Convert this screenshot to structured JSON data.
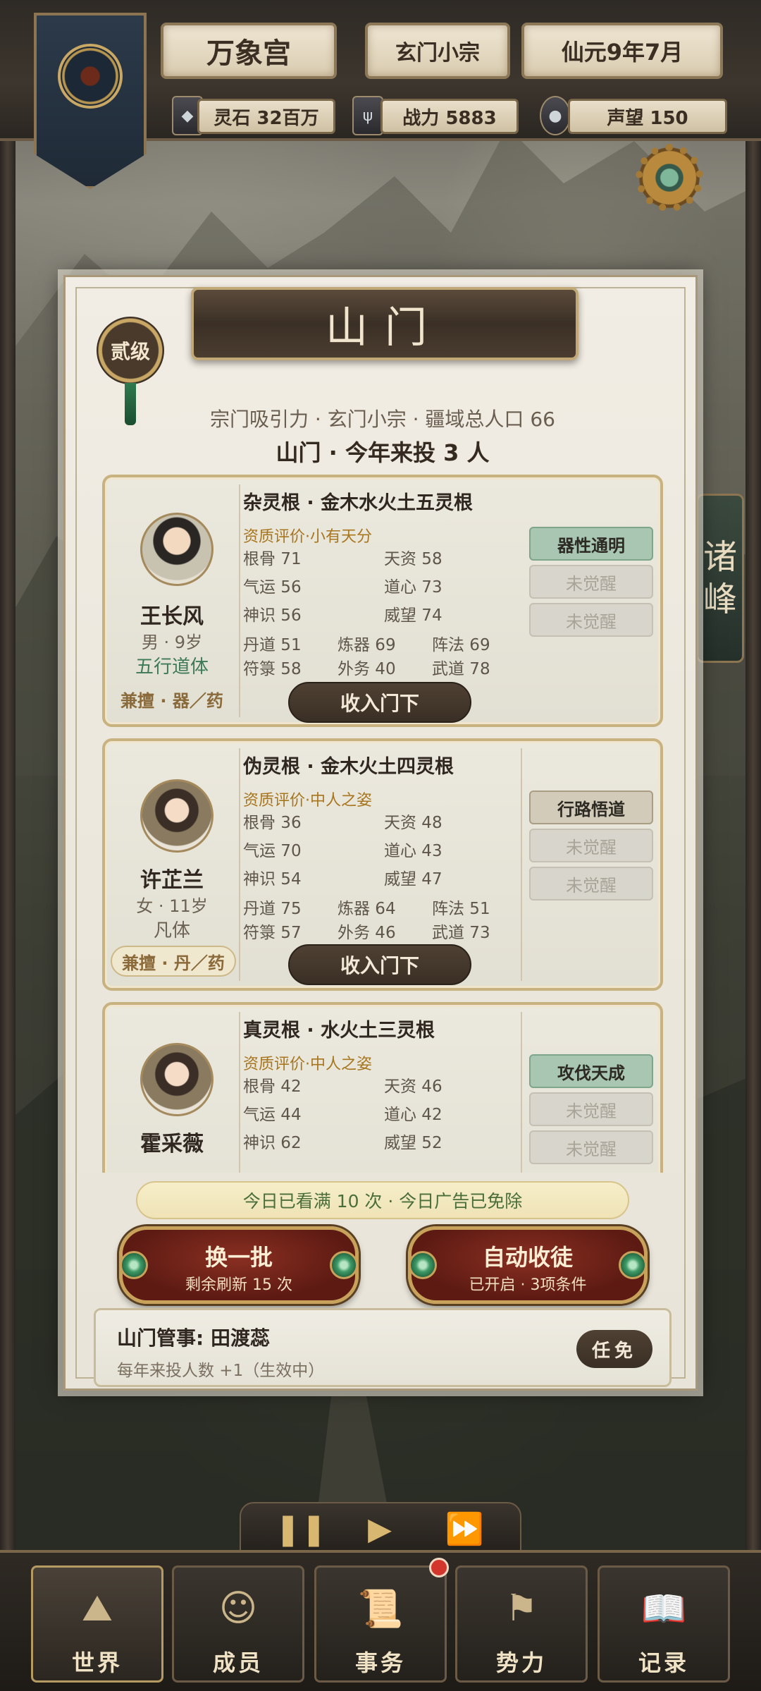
{
  "topbar": {
    "sect_name": "万象宫",
    "sect_rank": "玄门小宗",
    "date": "仙元9年7月",
    "resources": [
      {
        "icon": "spirit-stone-icon",
        "label": "灵石 32百万"
      },
      {
        "icon": "trident-icon",
        "label": "战力 5883"
      },
      {
        "icon": "reputation-orb-icon",
        "label": "声望 150"
      }
    ]
  },
  "side_tab": {
    "label_1": "诸",
    "label_2": "峰"
  },
  "panel": {
    "title": "山门",
    "rank_badge": "贰级",
    "info_line": "宗门吸引力 · 玄门小宗 · 疆域总人口 66",
    "info_strong": "山门 · 今年来投 3 人",
    "recruits": [
      {
        "name": "王长风",
        "meta": "男 · 9岁",
        "body": "五行道体",
        "specialty": "兼擅 · 器／药",
        "root": "杂灵根 · 金木水火土五灵根",
        "aptitude": "资质评价·小有天分",
        "stats": {
          "gengu": "根骨 71",
          "tianzi": "天资 58",
          "qiyun": "气运 56",
          "daoxin": "道心 73",
          "shenshi": "神识 56",
          "weiwang": "威望 74",
          "dandao": "丹道 51",
          "lianqi": "炼器 69",
          "zhenfa": "阵法 69",
          "fulu": "符箓 58",
          "waiwu": "外务 40",
          "wudao": "武道 78"
        },
        "traits": [
          "器性通明",
          "未觉醒",
          "未觉醒"
        ],
        "recruit_label": "收入门下"
      },
      {
        "name": "许芷兰",
        "meta": "女 · 11岁",
        "body": "凡体",
        "specialty": "兼擅 · 丹／药",
        "root": "伪灵根 · 金木火土四灵根",
        "aptitude": "资质评价·中人之姿",
        "stats": {
          "gengu": "根骨 36",
          "tianzi": "天资 48",
          "qiyun": "气运 70",
          "daoxin": "道心 43",
          "shenshi": "神识 54",
          "weiwang": "威望 47",
          "dandao": "丹道 75",
          "lianqi": "炼器 64",
          "zhenfa": "阵法 51",
          "fulu": "符箓 57",
          "waiwu": "外务 46",
          "wudao": "武道 73"
        },
        "traits": [
          "行路悟道",
          "未觉醒",
          "未觉醒"
        ],
        "recruit_label": "收入门下"
      },
      {
        "name": "霍采薇",
        "root": "真灵根 · 水火土三灵根",
        "aptitude": "资质评价·中人之姿",
        "stats": {
          "gengu": "根骨 42",
          "tianzi": "天资 46",
          "qiyun": "气运 44",
          "daoxin": "道心 42",
          "shenshi": "神识 62",
          "weiwang": "威望 52"
        },
        "traits": [
          "攻伐天成",
          "未觉醒",
          "未觉醒"
        ]
      }
    ],
    "ad_notice": "今日已看满 10 次 · 今日广告已免除",
    "refresh_button": {
      "title": "换一批",
      "sub": "剩余刷新 15 次"
    },
    "auto_button": {
      "title": "自动收徒",
      "sub": "已开启 · 3项条件"
    },
    "steward": {
      "title": "山门管事: 田渡蕊",
      "desc": "每年来投人数 +1（生效中）",
      "appoint_label": "任免"
    }
  },
  "nav": [
    {
      "label": "世界",
      "icon": "world-icon"
    },
    {
      "label": "成员",
      "icon": "member-icon"
    },
    {
      "label": "事务",
      "icon": "affairs-scroll-icon"
    },
    {
      "label": "势力",
      "icon": "faction-banner-icon"
    },
    {
      "label": "记录",
      "icon": "record-book-icon"
    }
  ]
}
